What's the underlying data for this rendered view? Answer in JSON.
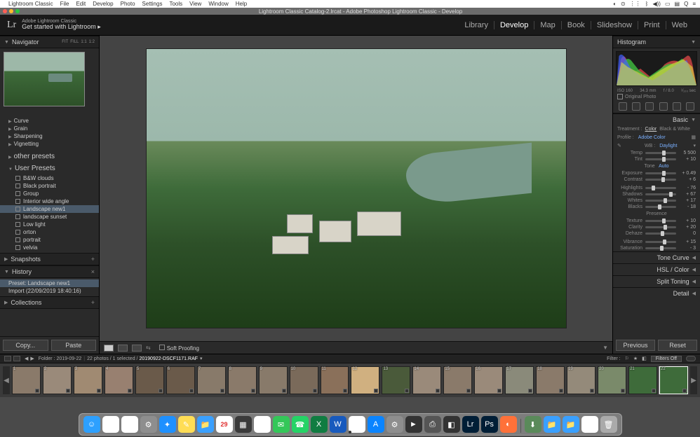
{
  "mac_menu": {
    "app": "Lightroom Classic",
    "items": [
      "File",
      "Edit",
      "Develop",
      "Photo",
      "Settings",
      "Tools",
      "View",
      "Window",
      "Help"
    ]
  },
  "window_title": "Lightroom Classic Catalog-2.lrcat - Adobe Photoshop Lightroom Classic - Develop",
  "branding": {
    "line1": "Adobe Lightroom Classic",
    "line2": "Get started with Lightroom  ▸"
  },
  "modules": [
    "Library",
    "Develop",
    "Map",
    "Book",
    "Slideshow",
    "Print",
    "Web"
  ],
  "active_module": "Develop",
  "navigator": {
    "title": "Navigator",
    "modes": [
      "FIT",
      "FILL",
      "1:1",
      "1:2"
    ]
  },
  "preset_groups_top": [
    "Curve",
    "Grain",
    "Sharpening",
    "Vignetting"
  ],
  "other_presets": "other presets",
  "user_presets_header": "User Presets",
  "user_presets": [
    "B&W clouds",
    "Black portrait",
    "Group",
    "Interior wide angle",
    "Landscape new1",
    "landscape sunset",
    "Low light",
    "orton",
    "portrait",
    "velvia"
  ],
  "selected_preset": "Landscape new1",
  "snapshots": "Snapshots",
  "history": {
    "title": "History",
    "items": [
      "Preset: Landscape new1",
      "Import (22/09/2019 18:40:16)"
    ],
    "selected": "Preset: Landscape new1"
  },
  "collections": "Collections",
  "copy_btn": "Copy...",
  "paste_btn": "Paste",
  "soft_proof": "Soft Proofing",
  "right": {
    "histogram": "Histogram",
    "histo_meta": [
      "ISO 160",
      "34.3 mm",
      "f / 8.0",
      "¹⁄₁₀₀ sec"
    ],
    "orig_photo": "Original Photo",
    "basic": "Basic",
    "treatment": "Treatment :",
    "treat_opts": [
      "Color",
      "Black & White"
    ],
    "profile": "Profile :",
    "profile_val": "Adobe Color",
    "wb": "WB :",
    "wb_val": "Daylight",
    "sliders": [
      {
        "k": "Temp",
        "v": "5 500",
        "p": 55
      },
      {
        "k": "Tint",
        "v": "+ 10",
        "p": 55
      }
    ],
    "tone": "Tone",
    "tone_auto": "Auto",
    "tone_sliders": [
      {
        "k": "Exposure",
        "v": "+ 0.49",
        "p": 55
      },
      {
        "k": "Contrast",
        "v": "+ 6",
        "p": 53
      }
    ],
    "tone_sliders2": [
      {
        "k": "Highlights",
        "v": "- 76",
        "p": 20
      },
      {
        "k": "Shadows",
        "v": "+ 67",
        "p": 78
      },
      {
        "k": "Whites",
        "v": "+ 17",
        "p": 58
      },
      {
        "k": "Blacks",
        "v": "- 18",
        "p": 42
      }
    ],
    "presence": "Presence",
    "presence_sliders": [
      {
        "k": "Texture",
        "v": "+ 10",
        "p": 55
      },
      {
        "k": "Clarity",
        "v": "+ 20",
        "p": 60
      },
      {
        "k": "Dehaze",
        "v": "0",
        "p": 50
      }
    ],
    "presence_sliders2": [
      {
        "k": "Vibrance",
        "v": "+ 15",
        "p": 57
      },
      {
        "k": "Saturation",
        "v": "- 3",
        "p": 48
      }
    ],
    "sections": [
      "Tone Curve",
      "HSL / Color",
      "Split Toning",
      "Detail"
    ],
    "prev": "Previous",
    "reset": "Reset"
  },
  "filmstrip": {
    "folder": "Folder : 2019-09-22",
    "count": "22 photos / 1 selected /",
    "filename": "20190922-DSCF1171.RAF",
    "filter_label": "Filter :",
    "filters_off": "Filters Off",
    "thumbs": [
      1,
      2,
      3,
      4,
      5,
      6,
      7,
      8,
      9,
      10,
      11,
      12,
      13,
      14,
      15,
      16,
      17,
      18,
      19,
      20,
      21,
      22
    ],
    "thumb_colors": [
      "#8a7a6a",
      "#9a8a7a",
      "#a08a72",
      "#988070",
      "#6a5a4a",
      "#6a5a4a",
      "#887a6a",
      "#8a7a6a",
      "#887a6a",
      "#7a6a5a",
      "#8a705a",
      "#d0b080",
      "#4a5a3a",
      "#9a8a7a",
      "#8a7a6a",
      "#9a8a7a",
      "#8a8a7a",
      "#8a7a6a",
      "#948a7a",
      "#7a8a6a",
      "#3e6b3a",
      "#3e6b3a"
    ],
    "selected_index": 21
  },
  "dock_icons": [
    {
      "n": "finder",
      "c": "#2da0ff",
      "t": "☺"
    },
    {
      "n": "photos",
      "c": "#fff",
      "t": "✿"
    },
    {
      "n": "chrome",
      "c": "#fff",
      "t": "◉"
    },
    {
      "n": "settings",
      "c": "#8e8e8e",
      "t": "⚙"
    },
    {
      "n": "safari",
      "c": "#1e90ff",
      "t": "✦"
    },
    {
      "n": "notes",
      "c": "#ffdd55",
      "t": "✎"
    },
    {
      "n": "folder",
      "c": "#3aa0ff",
      "t": "📁"
    },
    {
      "n": "calendar",
      "c": "#fff",
      "t": "29"
    },
    {
      "n": "preview",
      "c": "#3a3a3a",
      "t": "▦"
    },
    {
      "n": "maps",
      "c": "#fff",
      "t": "⌖"
    },
    {
      "n": "messages",
      "c": "#34c759",
      "t": "✉"
    },
    {
      "n": "whatsapp",
      "c": "#25d366",
      "t": "☎"
    },
    {
      "n": "excel",
      "c": "#107c41",
      "t": "X"
    },
    {
      "n": "word",
      "c": "#185abd",
      "t": "W"
    },
    {
      "n": "itunes",
      "c": "#fff",
      "t": "♫"
    },
    {
      "n": "appstore",
      "c": "#0a84ff",
      "t": "A"
    },
    {
      "n": "sysprefs",
      "c": "#8e8e8e",
      "t": "⚙"
    },
    {
      "n": "video",
      "c": "#333",
      "t": "►"
    },
    {
      "n": "scan",
      "c": "#555",
      "t": "⎙"
    },
    {
      "n": "dark1",
      "c": "#333",
      "t": "◧"
    },
    {
      "n": "lightroom",
      "c": "#001e36",
      "t": "Lr"
    },
    {
      "n": "photoshop",
      "c": "#001e36",
      "t": "Ps"
    },
    {
      "n": "firefox",
      "c": "#ff7139",
      "t": "◐"
    }
  ],
  "dock_right": [
    {
      "n": "downloads",
      "c": "#5a8a5a",
      "t": "⬇"
    },
    {
      "n": "folder1",
      "c": "#3aa0ff",
      "t": "📁"
    },
    {
      "n": "folder2",
      "c": "#3aa0ff",
      "t": "📁"
    },
    {
      "n": "doc",
      "c": "#fff",
      "t": "≡"
    },
    {
      "n": "trash",
      "c": "#aaa",
      "t": "🗑"
    }
  ]
}
